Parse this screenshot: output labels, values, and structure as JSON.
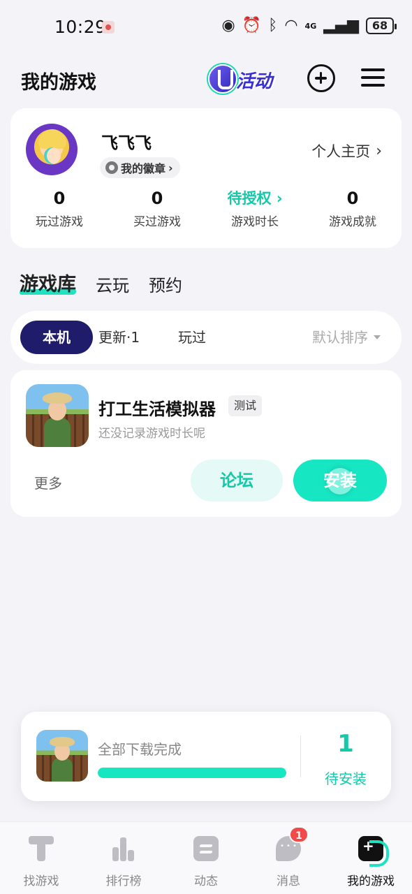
{
  "status_bar": {
    "time": "10:29",
    "network": "4G",
    "battery": "68",
    "icons": [
      "eye-icon",
      "alarm-icon",
      "bluetooth-icon",
      "wifi-icon",
      "signal-icon"
    ]
  },
  "header": {
    "title": "我的游戏",
    "activity_label": "活动",
    "add_icon": "add-circle-icon",
    "menu_icon": "menu-icon"
  },
  "profile": {
    "username": "飞飞飞",
    "badge_label": "我的徽章",
    "homepage_label": "个人主页",
    "stats": [
      {
        "value": "0",
        "label": "玩过游戏"
      },
      {
        "value": "0",
        "label": "买过游戏"
      },
      {
        "value": "待授权",
        "label": "游戏时长"
      },
      {
        "value": "0",
        "label": "游戏成就"
      }
    ]
  },
  "tabs": [
    {
      "label": "游戏库",
      "active": true
    },
    {
      "label": "云玩",
      "active": false
    },
    {
      "label": "预约",
      "active": false
    }
  ],
  "filters": {
    "local": "本机",
    "updates": "更新·1",
    "played": "玩过",
    "sort": "默认排序"
  },
  "game": {
    "name": "打工生活模拟器",
    "tag": "测试",
    "subtitle": "还没记录游戏时长呢",
    "more": "更多",
    "forum": "论坛",
    "install": "安装"
  },
  "download": {
    "status": "全部下载完成",
    "progress": 1.0,
    "count": "1",
    "count_label": "待安装"
  },
  "nav": [
    {
      "label": "找游戏",
      "active": false
    },
    {
      "label": "排行榜",
      "active": false
    },
    {
      "label": "动态",
      "active": false
    },
    {
      "label": "消息",
      "active": false,
      "badge": "1"
    },
    {
      "label": "我的游戏",
      "active": true
    }
  ],
  "colors": {
    "accent": "#17e6c3",
    "dark_chip": "#1f1d6b",
    "badge_red": "#f04b4b"
  }
}
